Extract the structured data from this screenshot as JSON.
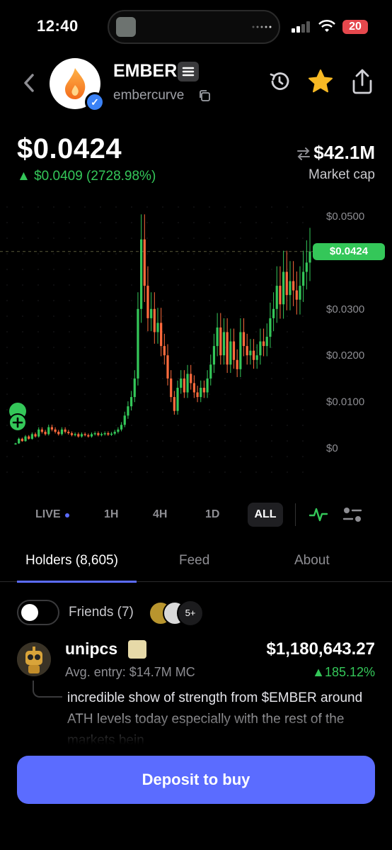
{
  "status_bar": {
    "time": "12:40",
    "battery": "20"
  },
  "header": {
    "token_name": "EMBER",
    "handle": "embercurve"
  },
  "price": {
    "current": "$0.0424",
    "change": "▲ $0.0409 (2728.98%)",
    "market_cap": "$42.1M",
    "market_cap_label": "Market cap"
  },
  "chart": {
    "current_price_label": "$0.0424",
    "y_ticks": [
      "$0.0500",
      "$0.0300",
      "$0.0200",
      "$0.0100",
      "$0"
    ]
  },
  "chart_data": {
    "type": "candlestick",
    "ylim": [
      0,
      0.05
    ],
    "y_ticks": [
      0.05,
      0.03,
      0.02,
      0.01,
      0
    ],
    "current_price": 0.0424,
    "close_series": [
      0.001,
      0.002,
      0.0015,
      0.0025,
      0.002,
      0.003,
      0.0025,
      0.004,
      0.0035,
      0.003,
      0.0045,
      0.004,
      0.0035,
      0.003,
      0.004,
      0.0035,
      0.0032,
      0.0028,
      0.003,
      0.0025,
      0.003,
      0.0028,
      0.0025,
      0.003,
      0.0032,
      0.0028,
      0.003,
      0.0032,
      0.0029,
      0.0031,
      0.0035,
      0.004,
      0.005,
      0.007,
      0.009,
      0.011,
      0.015,
      0.03,
      0.045,
      0.035,
      0.028,
      0.03,
      0.025,
      0.027,
      0.022,
      0.02,
      0.015,
      0.011,
      0.008,
      0.013,
      0.015,
      0.012,
      0.016,
      0.014,
      0.012,
      0.011,
      0.013,
      0.012,
      0.015,
      0.018,
      0.022,
      0.026,
      0.02,
      0.025,
      0.018,
      0.023,
      0.019,
      0.017,
      0.025,
      0.022,
      0.02,
      0.021,
      0.019,
      0.02,
      0.023,
      0.022,
      0.024,
      0.028,
      0.03,
      0.035,
      0.031,
      0.038,
      0.033,
      0.036,
      0.034,
      0.032,
      0.035,
      0.038,
      0.04,
      0.0424
    ]
  },
  "timeframes": {
    "live": "LIVE",
    "h1": "1H",
    "h4": "4H",
    "d1": "1D",
    "all": "ALL"
  },
  "tabs": {
    "holders": "Holders (8,605)",
    "feed": "Feed",
    "about": "About"
  },
  "friends": {
    "label": "Friends (7)",
    "more": "5+"
  },
  "holder": {
    "name": "unipcs",
    "value": "$1,180,643.27",
    "entry": "Avg. entry: $14.7M MC",
    "pnl": "▲185.12%",
    "comment": "incredible show of strength from $EMBER around ATH levels today especially with the rest of the markets bein"
  },
  "cta": {
    "label": "Deposit to buy"
  },
  "colors": {
    "accent": "#5b6cff",
    "up": "#34c759",
    "down": "#ff6b3d"
  }
}
